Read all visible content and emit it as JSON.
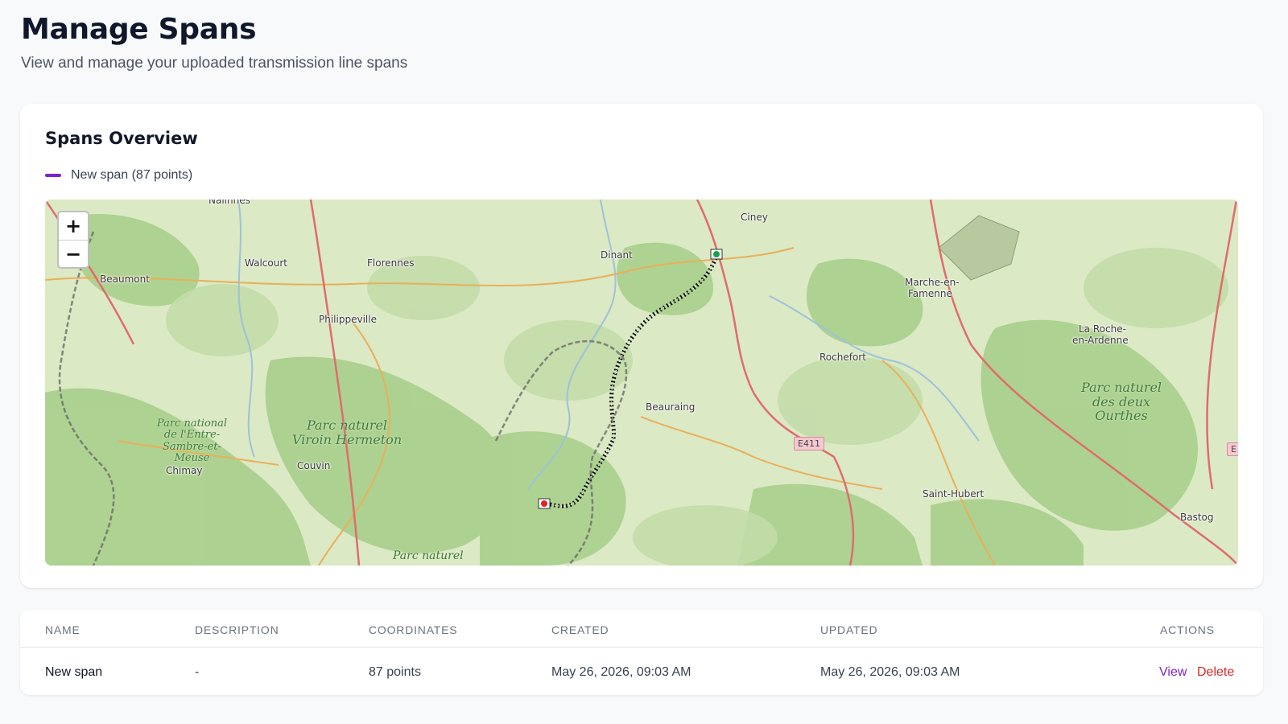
{
  "header": {
    "title": "Manage Spans",
    "subtitle": "View and manage your uploaded transmission line spans"
  },
  "overview": {
    "title": "Spans Overview",
    "legend": [
      {
        "label": "New span (87 points)",
        "color": "#7e22ce"
      }
    ],
    "zoom": {
      "in": "+",
      "out": "−"
    },
    "map_labels": {
      "places": [
        "Nalinnes",
        "Walcourt",
        "Florennes",
        "Dinant",
        "Ciney",
        "Beaumont",
        "Philippeville",
        "Marche-en-",
        "Famenne",
        "Rochefort",
        "La Roche-",
        "en-Ardenne",
        "Beauraing",
        "Couvin",
        "Chimay",
        "Saint-Hubert",
        "Bastog",
        "Parc naturel"
      ],
      "parks": [
        "Parc national de l'Entre-Sambre-et-Meuse",
        "Parc naturel Viroin Hermeton",
        "Parc naturel des deux Ourthes"
      ],
      "roads": [
        "E411",
        "E"
      ]
    },
    "markers": {
      "start_color": "#16a34a",
      "end_color": "#dc2626"
    }
  },
  "table": {
    "headers": [
      "NAME",
      "DESCRIPTION",
      "COORDINATES",
      "CREATED",
      "UPDATED",
      "ACTIONS"
    ],
    "rows": [
      {
        "name": "New span",
        "description": "-",
        "coordinates": "87 points",
        "created": "May 26, 2026, 09:03 AM",
        "updated": "May 26, 2026, 09:03 AM",
        "view": "View",
        "delete": "Delete"
      }
    ]
  }
}
